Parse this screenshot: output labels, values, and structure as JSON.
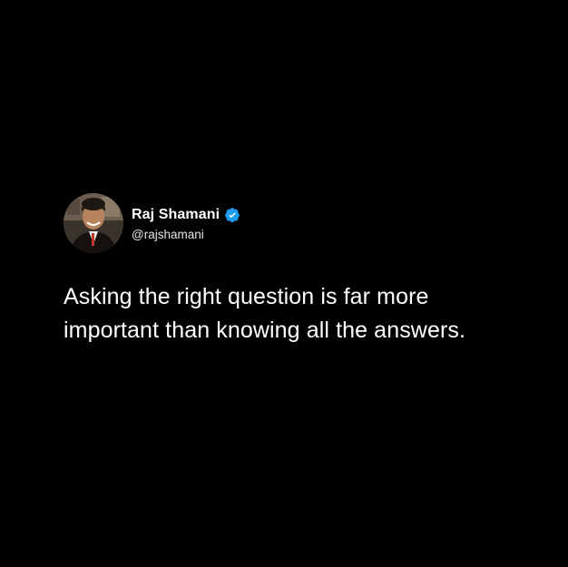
{
  "author": {
    "display_name": "Raj Shamani",
    "handle": "@rajshamani",
    "verified": true,
    "verified_icon": "verified-badge-icon",
    "verified_color": "#1d9bf0"
  },
  "tweet": {
    "text": "Asking the right question is far more important than knowing all the answers."
  },
  "theme": {
    "background": "#000000",
    "text_color": "#ffffff"
  }
}
